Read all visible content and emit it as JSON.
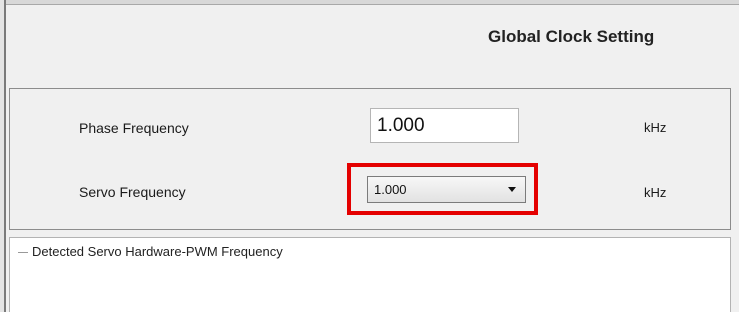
{
  "header": {
    "title": "Global Clock Setting"
  },
  "settings": {
    "phase": {
      "label": "Phase Frequency",
      "value": "1.000",
      "unit": "kHz"
    },
    "servo": {
      "label": "Servo Frequency",
      "selected": "1.000",
      "unit": "kHz"
    }
  },
  "detected": {
    "label": "Detected Servo Hardware-PWM Frequency"
  },
  "colors": {
    "highlight": "#e40000",
    "panel_bg": "#f0f0f0"
  }
}
